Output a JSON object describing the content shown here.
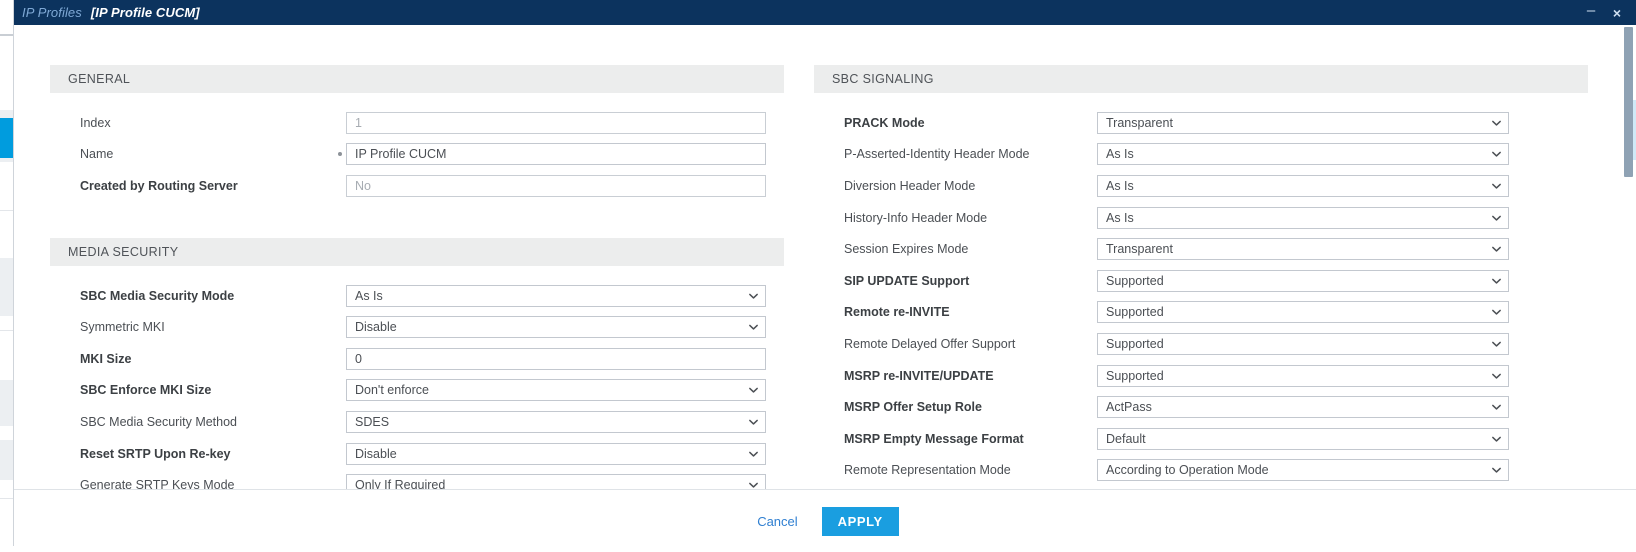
{
  "titlebar": {
    "breadcrumb": "IP Profiles",
    "title": "[IP Profile CUCM]",
    "minimize_icon": "minimize-icon",
    "minimize_glyph": "–",
    "close_icon": "close-icon",
    "close_glyph": "×"
  },
  "left_column": {
    "sections": [
      {
        "heading": "GENERAL",
        "rows": [
          {
            "label": "Index",
            "value": "1",
            "type": "text",
            "readonly": true,
            "bold": false,
            "required": false
          },
          {
            "label": "Name",
            "value": "IP Profile CUCM",
            "type": "text",
            "readonly": false,
            "bold": false,
            "required": true
          },
          {
            "label": "Created by Routing Server",
            "value": "No",
            "type": "text",
            "readonly": true,
            "bold": true,
            "required": false
          }
        ]
      },
      {
        "heading": "MEDIA SECURITY",
        "rows": [
          {
            "label": "SBC Media Security Mode",
            "value": "As Is",
            "type": "select",
            "readonly": false,
            "bold": true,
            "required": false
          },
          {
            "label": "Symmetric MKI",
            "value": "Disable",
            "type": "select",
            "readonly": false,
            "bold": false,
            "required": false
          },
          {
            "label": "MKI Size",
            "value": "0",
            "type": "text",
            "readonly": false,
            "bold": true,
            "required": false
          },
          {
            "label": "SBC Enforce MKI Size",
            "value": "Don't enforce",
            "type": "select",
            "readonly": false,
            "bold": true,
            "required": false
          },
          {
            "label": "SBC Media Security Method",
            "value": "SDES",
            "type": "select",
            "readonly": false,
            "bold": false,
            "required": false
          },
          {
            "label": "Reset SRTP Upon Re-key",
            "value": "Disable",
            "type": "select",
            "readonly": false,
            "bold": true,
            "required": false
          },
          {
            "label": "Generate SRTP Keys Mode",
            "value": "Only If Required",
            "type": "select",
            "readonly": false,
            "bold": false,
            "required": false
          }
        ]
      }
    ]
  },
  "right_column": {
    "sections": [
      {
        "heading": "SBC SIGNALING",
        "rows": [
          {
            "label": "PRACK Mode",
            "value": "Transparent",
            "type": "select",
            "readonly": false,
            "bold": true,
            "required": false
          },
          {
            "label": "P-Asserted-Identity Header Mode",
            "value": "As Is",
            "type": "select",
            "readonly": false,
            "bold": false,
            "required": false
          },
          {
            "label": "Diversion Header Mode",
            "value": "As Is",
            "type": "select",
            "readonly": false,
            "bold": false,
            "required": false
          },
          {
            "label": "History-Info Header Mode",
            "value": "As Is",
            "type": "select",
            "readonly": false,
            "bold": false,
            "required": false
          },
          {
            "label": "Session Expires Mode",
            "value": "Transparent",
            "type": "select",
            "readonly": false,
            "bold": false,
            "required": false
          },
          {
            "label": "SIP UPDATE Support",
            "value": "Supported",
            "type": "select",
            "readonly": false,
            "bold": true,
            "required": false
          },
          {
            "label": "Remote re-INVITE",
            "value": "Supported",
            "type": "select",
            "readonly": false,
            "bold": true,
            "required": false
          },
          {
            "label": "Remote Delayed Offer Support",
            "value": "Supported",
            "type": "select",
            "readonly": false,
            "bold": false,
            "required": false
          },
          {
            "label": "MSRP re-INVITE/UPDATE",
            "value": "Supported",
            "type": "select",
            "readonly": false,
            "bold": true,
            "required": false
          },
          {
            "label": "MSRP Offer Setup Role",
            "value": "ActPass",
            "type": "select",
            "readonly": false,
            "bold": true,
            "required": false
          },
          {
            "label": "MSRP Empty Message Format",
            "value": "Default",
            "type": "select",
            "readonly": false,
            "bold": true,
            "required": false
          },
          {
            "label": "Remote Representation Mode",
            "value": "According to Operation Mode",
            "type": "select",
            "readonly": false,
            "bold": false,
            "required": false
          }
        ]
      }
    ]
  },
  "footer": {
    "cancel_label": "Cancel",
    "apply_label": "APPLY"
  },
  "colors": {
    "titlebar": "#0c335e",
    "accent_blue": "#1a9ee0",
    "link_blue": "#2f7fd1",
    "section_header_bg": "#eceded",
    "field_border": "#c3c8cf"
  }
}
